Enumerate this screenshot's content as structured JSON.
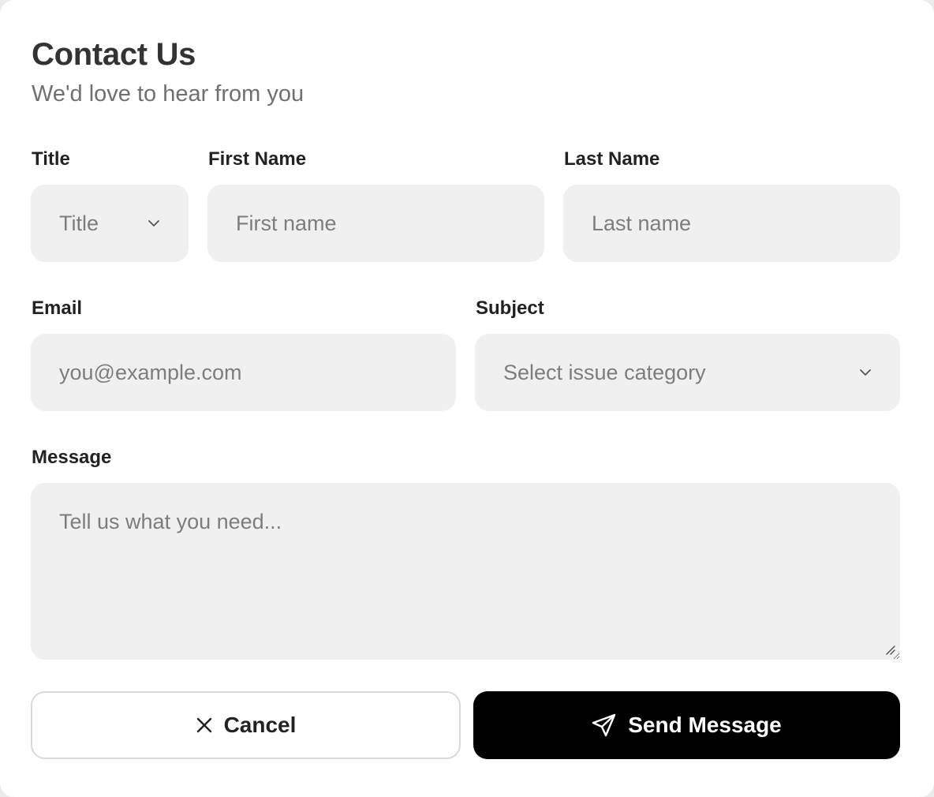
{
  "header": {
    "title": "Contact Us",
    "subtitle": "We'd love to hear from you"
  },
  "form": {
    "title_label": "Title",
    "title_select_value": "Title",
    "first_name_label": "First Name",
    "first_name_placeholder": "First name",
    "last_name_label": "Last Name",
    "last_name_placeholder": "Last name",
    "email_label": "Email",
    "email_placeholder": "you@example.com",
    "subject_label": "Subject",
    "subject_select_value": "Select issue category",
    "message_label": "Message",
    "message_placeholder": "Tell us what you need..."
  },
  "actions": {
    "cancel_label": "Cancel",
    "send_label": "Send Message"
  },
  "icons": {
    "title_chevron": "chevron-down-icon",
    "subject_chevron": "chevron-down-icon",
    "cancel": "close-icon",
    "send": "send-icon",
    "resize": "resize-grip-icon"
  },
  "colors": {
    "field_background": "#f0f0f0",
    "primary_button": "#000000",
    "secondary_button_border": "#d9d9d9",
    "title_text": "#333333",
    "placeholder_text": "#7d7d7d"
  }
}
